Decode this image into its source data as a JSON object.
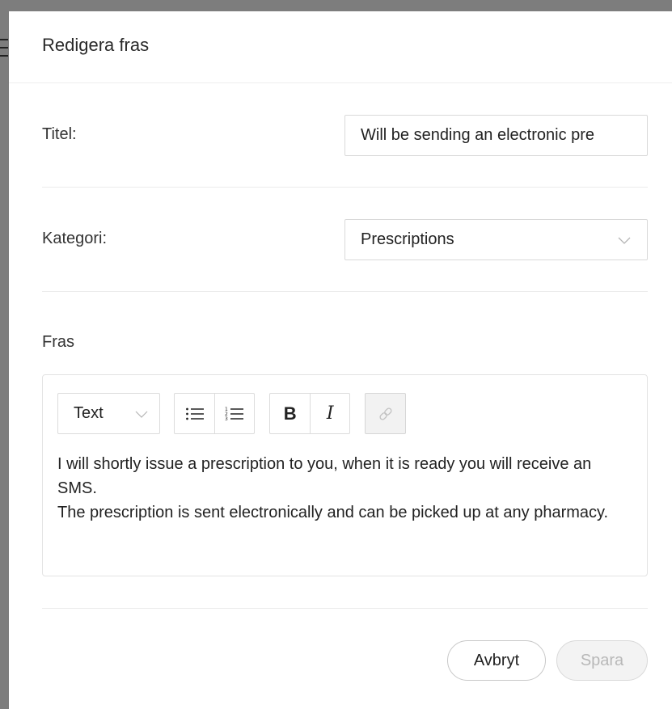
{
  "modal": {
    "title": "Redigera fras"
  },
  "form": {
    "title_label": "Titel:",
    "title_value": "Will be sending an electronic pre",
    "category_label": "Kategori:",
    "category_value": "Prescriptions",
    "phrase_label": "Fras"
  },
  "editor": {
    "text_style": "Text",
    "toolbar": {
      "bold_label": "B",
      "italic_label": "I",
      "icons": [
        "bulleted-list-icon",
        "numbered-list-icon",
        "link-icon"
      ],
      "link_enabled": false
    },
    "content": {
      "line1": "I will shortly issue a prescription to you, when it is ready you will receive an SMS.",
      "line2": "The prescription is sent electronically and can be picked up at any pharmacy."
    }
  },
  "buttons": {
    "cancel_label": "Avbryt",
    "save_label": "Spara",
    "save_enabled": false
  }
}
